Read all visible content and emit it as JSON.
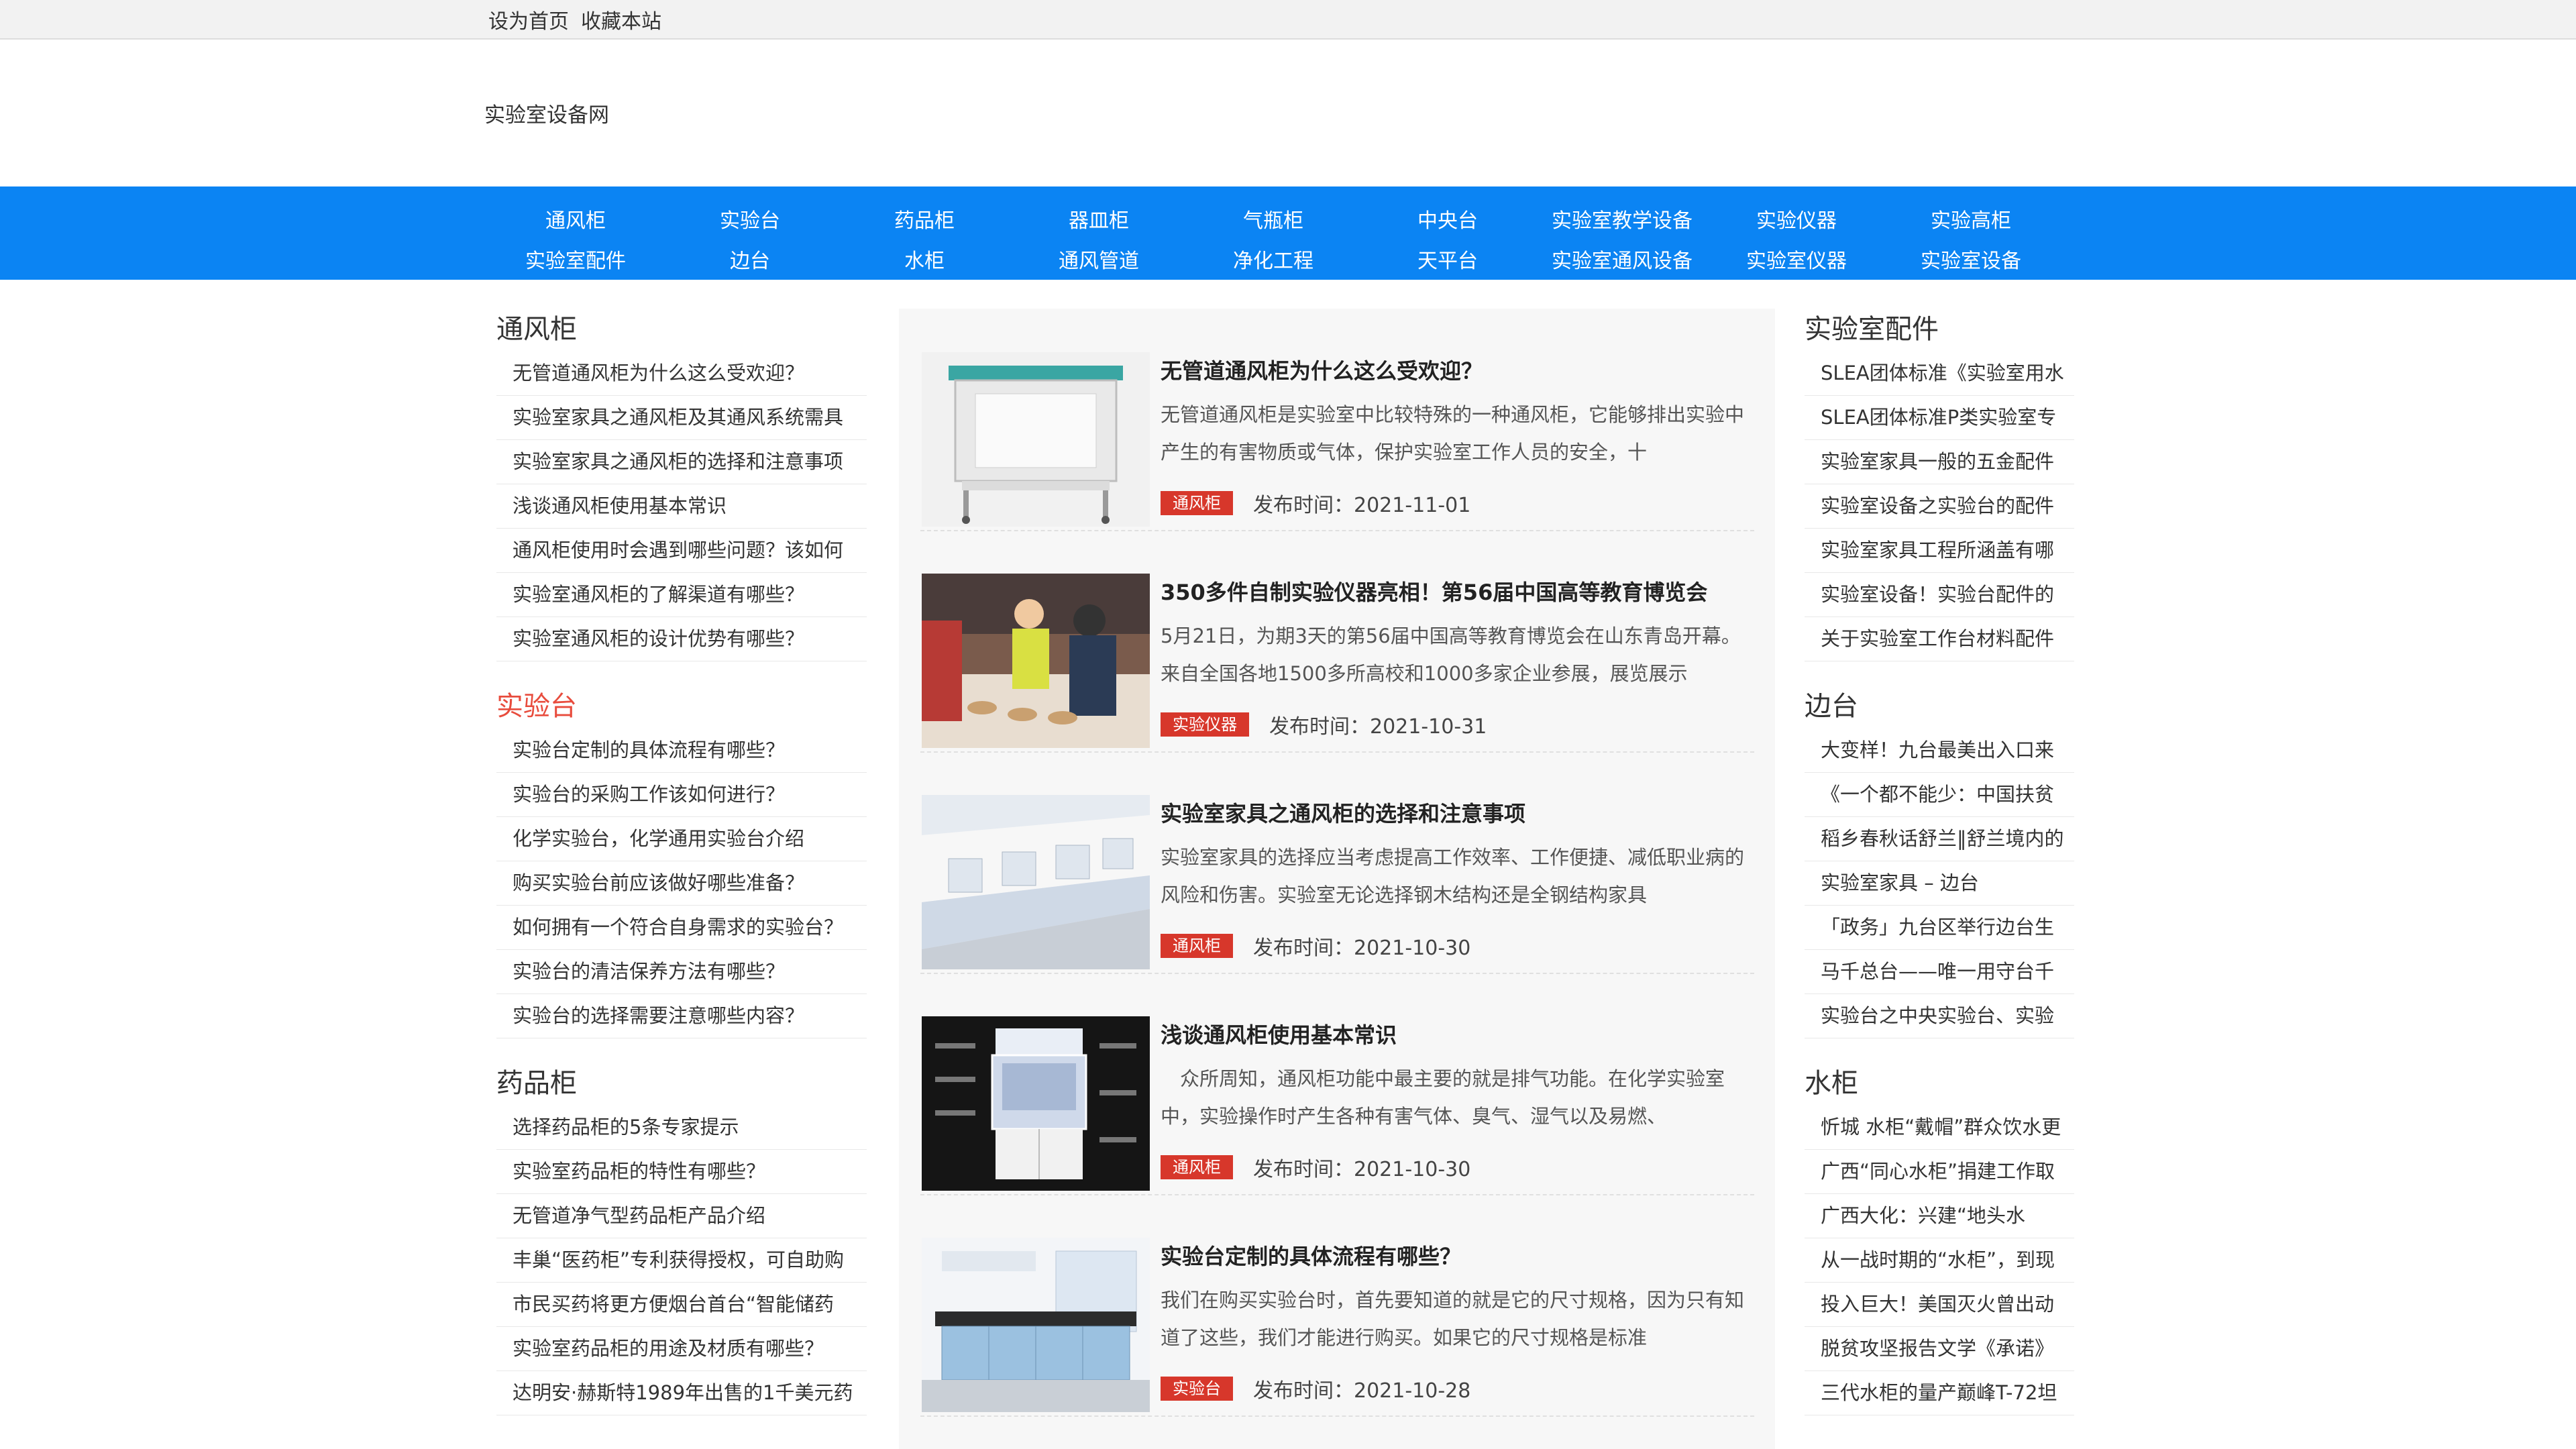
{
  "topbar": {
    "set_home": "设为首页",
    "bookmark": "收藏本站"
  },
  "header": {
    "site_title": "实验室设备网"
  },
  "nav": {
    "row1": [
      "通风柜",
      "实验台",
      "药品柜",
      "器皿柜",
      "气瓶柜",
      "中央台",
      "实验室教学设备",
      "实验仪器",
      "实验高柜"
    ],
    "row2": [
      "实验室配件",
      "边台",
      "水柜",
      "通风管道",
      "净化工程",
      "天平台",
      "实验室通风设备",
      "实验室仪器",
      "实验室设备"
    ]
  },
  "left": {
    "sections": [
      {
        "title": "通风柜",
        "items": [
          "无管道通风柜为什么这么受欢迎？",
          "实验室家具之通风柜及其通风系统需具",
          "实验室家具之通风柜的选择和注意事项",
          "浅谈通风柜使用基本常识",
          "通风柜使用时会遇到哪些问题？该如何",
          "实验室通风柜的了解渠道有哪些？",
          "实验室通风柜的设计优势有哪些？"
        ]
      },
      {
        "title": "实验台",
        "items": [
          "实验台定制的具体流程有哪些？",
          "实验台的采购工作该如何进行？",
          "化学实验台，化学通用实验台介绍",
          "购买实验台前应该做好哪些准备？",
          "如何拥有一个符合自身需求的实验台？",
          "实验台的清洁保养方法有哪些？",
          "实验台的选择需要注意哪些内容？"
        ]
      },
      {
        "title": "药品柜",
        "items": [
          "选择药品柜的5条专家提示",
          "实验室药品柜的特性有哪些？",
          "无管道净气型药品柜产品介绍",
          "丰巢“医药柜”专利获得授权，可自助购",
          "市民买药将更方便烟台首台“智能储药",
          "实验室药品柜的用途及材质有哪些？",
          "达明安·赫斯特1989年出售的1千美元药"
        ]
      }
    ]
  },
  "right": {
    "sections": [
      {
        "title": "实验室配件",
        "items": [
          "SLEA团体标准《实验室用水",
          "SLEA团体标准P类实验室专",
          "实验室家具一般的五金配件",
          "实验室设备之实验台的配件",
          "实验室家具工程所涵盖有哪",
          "实验室设备！实验台配件的",
          "关于实验室工作台材料配件"
        ]
      },
      {
        "title": "边台",
        "items": [
          "大变样！九台最美出入口来",
          "《一个都不能少：中国扶贫",
          "稻乡春秋话舒兰‖舒兰境内的",
          "实验室家具 – 边台",
          "「政务」九台区举行边台生",
          "马千总台——唯一用守台千",
          "实验台之中央实验台、实验"
        ]
      },
      {
        "title": "水柜",
        "items": [
          "忻城 水柜“戴帽”群众饮水更",
          "广西“同心水柜”捐建工作取",
          "广西大化：兴建“地头水",
          "从一战时期的“水柜”，到现",
          "投入巨大！美国灭火曾出动",
          "脱贫攻坚报告文学《承诺》",
          "三代水柜的量产巅峰T-72坦"
        ]
      }
    ]
  },
  "articles": [
    {
      "title": "无管道通风柜为什么这么受欢迎？",
      "desc": "无管道通风柜是实验室中比较特殊的一种通风柜，它能够排出实验中产生的有害物质或气体，保护实验室工作人员的安全，十",
      "tag": "通风柜",
      "date": "发布时间：2021-11-01",
      "thumb": "thumb-cabinet-icon"
    },
    {
      "title": "350多件自制实验仪器亮相！第56届中国高等教育博览会",
      "desc": "5月21日，为期3天的第56届中国高等教育博览会在山东青岛开幕。来自全国各地1500多所高校和1000多家企业参展，展览展示",
      "tag": "实验仪器",
      "date": "发布时间：2021-10-31",
      "thumb": "thumb-expo-icon"
    },
    {
      "title": "实验室家具之通风柜的选择和注意事项",
      "desc": "实验室家具的选择应当考虑提高工作效率、工作便捷、减低职业病的风险和伤害。实验室无论选择钢木结构还是全钢结构家具",
      "tag": "通风柜",
      "date": "发布时间：2021-10-30",
      "thumb": "thumb-lab-row-icon"
    },
    {
      "title": "浅谈通风柜使用基本常识",
      "desc": "　众所周知，通风柜功能中最主要的就是排气功能。在化学实验室中，实验操作时产生各种有害气体、臭气、湿气以及易燃、",
      "tag": "通风柜",
      "date": "发布时间：2021-10-30",
      "thumb": "thumb-fume-hood-icon"
    },
    {
      "title": "实验台定制的具体流程有哪些？",
      "desc": "我们在购买实验台时，首先要知道的就是它的尺寸规格，因为只有知道了这些，我们才能进行购买。如果它的尺寸规格是标准",
      "tag": "实验台",
      "date": "发布时间：2021-10-28",
      "thumb": "thumb-lab-bench-icon"
    }
  ]
}
